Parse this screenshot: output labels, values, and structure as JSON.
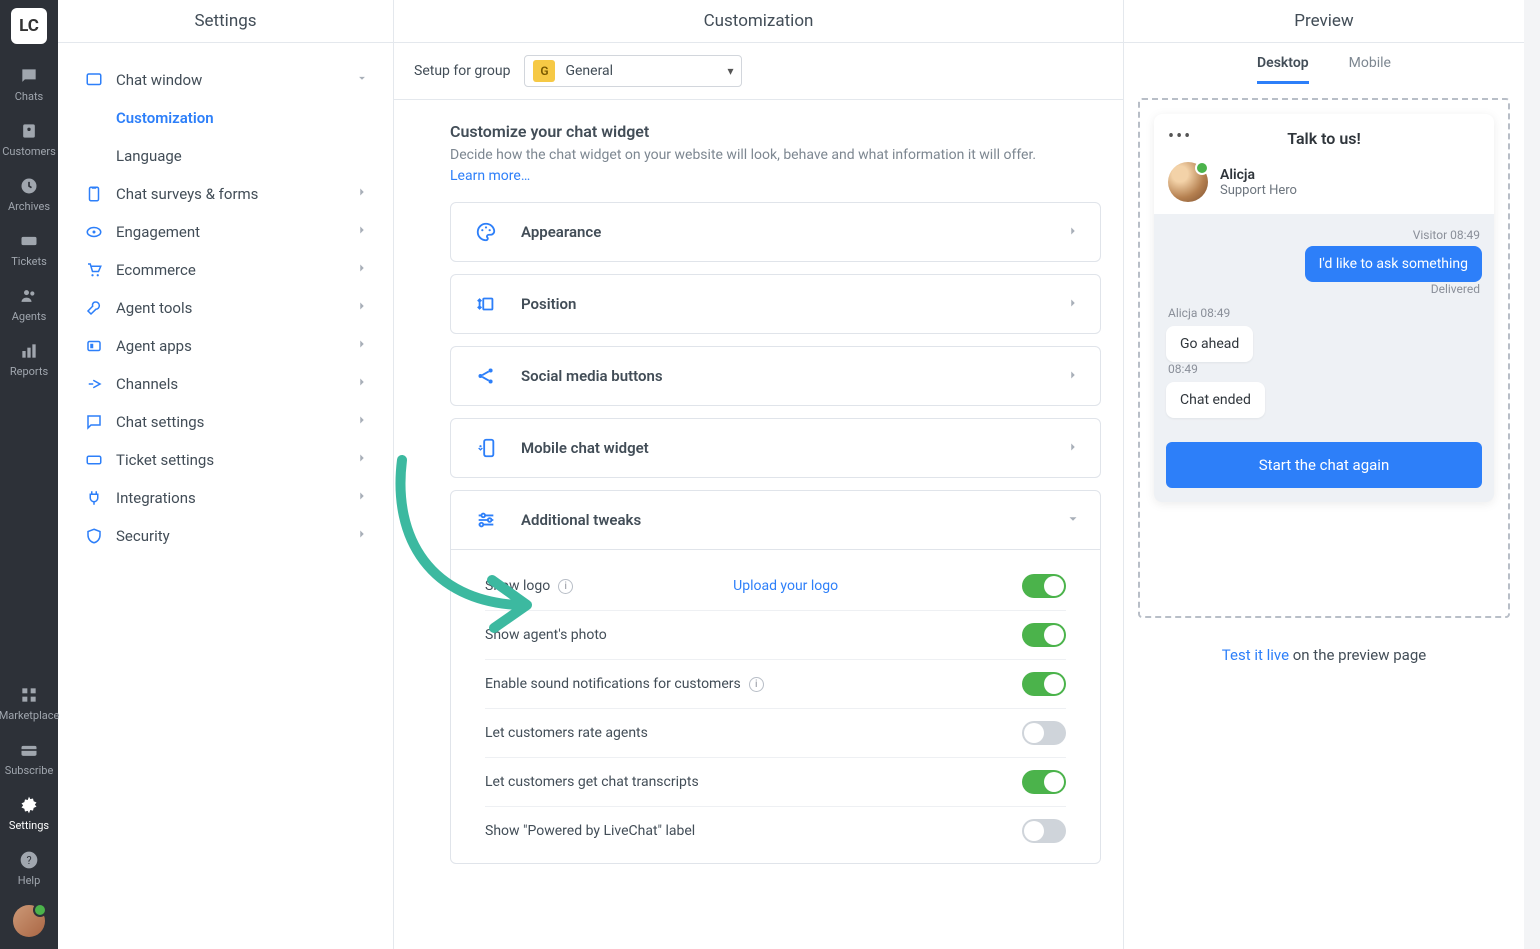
{
  "nav": {
    "logo": "LC",
    "items": [
      {
        "label": "Chats"
      },
      {
        "label": "Customers"
      },
      {
        "label": "Archives"
      },
      {
        "label": "Tickets"
      },
      {
        "label": "Agents"
      },
      {
        "label": "Reports"
      }
    ],
    "bottom": [
      {
        "label": "Marketplace"
      },
      {
        "label": "Subscribe"
      },
      {
        "label": "Settings"
      },
      {
        "label": "Help"
      }
    ]
  },
  "sidebar": {
    "header": "Settings",
    "chat_window": "Chat window",
    "customization": "Customization",
    "language": "Language",
    "rows": [
      "Chat surveys & forms",
      "Engagement",
      "Ecommerce",
      "Agent tools",
      "Agent apps",
      "Channels",
      "Chat settings",
      "Ticket settings",
      "Integrations",
      "Security"
    ]
  },
  "main": {
    "header": "Customization",
    "setup_label": "Setup for group",
    "group_badge": "G",
    "group_name": "General",
    "title": "Customize your chat widget",
    "desc": "Decide how the chat widget on your website will look, behave and what information it will offer.",
    "learn": "Learn more…",
    "panels": {
      "appearance": "Appearance",
      "position": "Position",
      "social": "Social media buttons",
      "mobile": "Mobile chat widget",
      "tweaks": "Additional tweaks"
    },
    "upload": "Upload your logo",
    "toggles": [
      {
        "label": "Show logo",
        "info": true,
        "on": true,
        "upload": true
      },
      {
        "label": "Show agent's photo",
        "on": true
      },
      {
        "label": "Enable sound notifications for customers",
        "info": true,
        "on": true
      },
      {
        "label": "Let customers rate agents",
        "on": false
      },
      {
        "label": "Let customers get chat transcripts",
        "on": true
      },
      {
        "label": "Show \"Powered by LiveChat\" label",
        "on": false
      }
    ]
  },
  "preview": {
    "header": "Preview",
    "tabs": {
      "desktop": "Desktop",
      "mobile": "Mobile"
    },
    "chat": {
      "title": "Talk to us!",
      "agent_name": "Alicja",
      "agent_role": "Support Hero",
      "visitor_meta": "Visitor 08:49",
      "user_msg": "I'd like to ask something",
      "delivered": "Delivered",
      "agent_meta": "Alicja 08:49",
      "agent_msg": "Go ahead",
      "time2": "08:49",
      "ended": "Chat ended",
      "button": "Start the chat again"
    },
    "test_live": "Test it live",
    "test_rest": " on the preview page"
  }
}
